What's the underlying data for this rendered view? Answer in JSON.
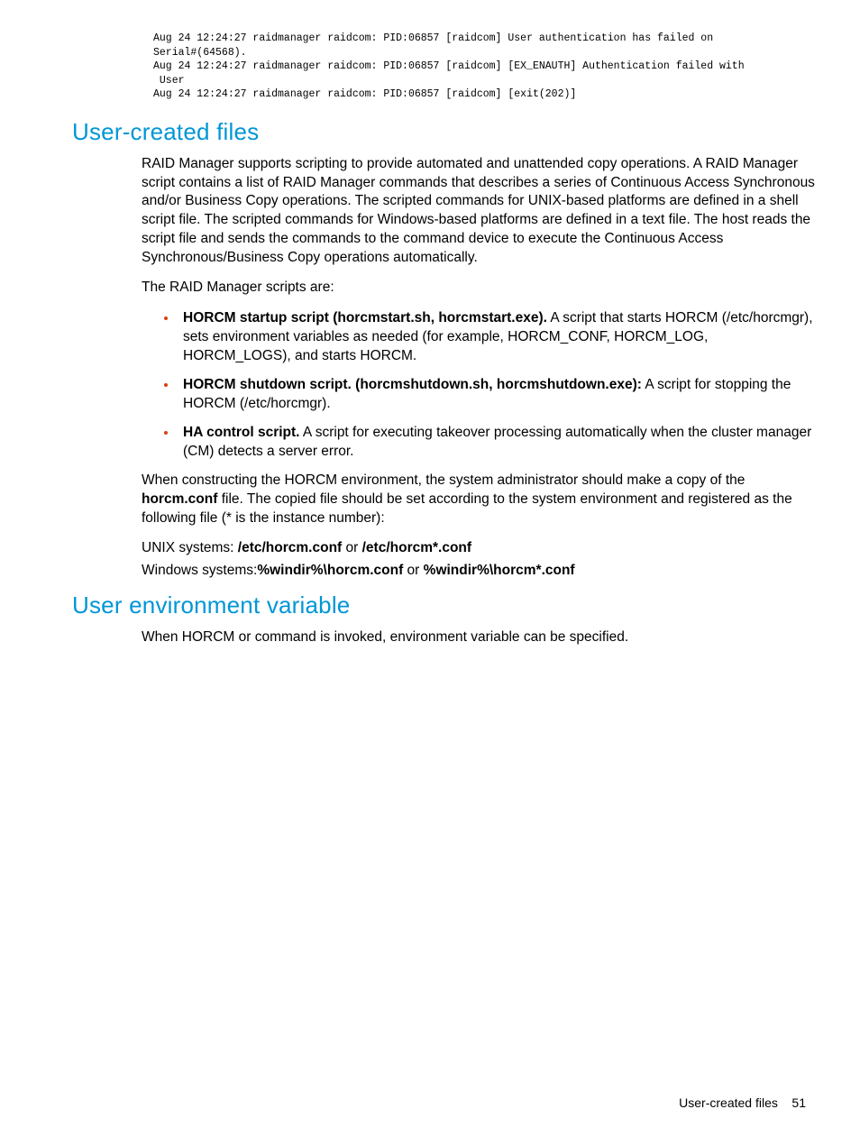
{
  "code": {
    "line1": "Aug 24 12:24:27 raidmanager raidcom: PID:06857 [raidcom] User authentication has failed on",
    "line2": "Serial#(64568).",
    "line3": "Aug 24 12:24:27 raidmanager raidcom: PID:06857 [raidcom] [EX_ENAUTH] Authentication failed with",
    "line4": " User",
    "line5": "Aug 24 12:24:27 raidmanager raidcom: PID:06857 [raidcom] [exit(202)]"
  },
  "section1": {
    "heading": "User-created files",
    "para1": "RAID Manager supports scripting to provide automated and unattended copy operations. A RAID Manager script contains a list of RAID Manager commands that describes a series of Continuous Access Synchronous and/or Business Copy operations. The scripted commands for UNIX-based platforms are defined in a shell script file. The scripted commands for Windows-based platforms are defined in a text file. The host reads the script file and sends the commands to the command device to execute the Continuous Access Synchronous/Business Copy operations automatically.",
    "para2": "The RAID Manager scripts are:",
    "bullets": [
      {
        "boldPart": "HORCM startup script (horcmstart.sh, horcmstart.exe).",
        "rest": " A script that starts HORCM (/etc/horcmgr), sets environment variables as needed (for example, HORCM_CONF, HORCM_LOG, HORCM_LOGS), and starts HORCM."
      },
      {
        "boldPart": "HORCM shutdown script. (horcmshutdown.sh, horcmshutdown.exe):",
        "rest": " A script for stopping the HORCM (/etc/horcmgr)."
      },
      {
        "boldPart": "HA control script.",
        "rest": " A script for executing takeover processing automatically when the cluster manager (CM) detects a server error."
      }
    ],
    "para3a": "When constructing the HORCM environment, the system administrator should make a copy of the ",
    "para3bold": "horcm.conf",
    "para3b": " file. The copied file should be set according to the system environment and registered as the following file (* is the instance number):",
    "unixLabel": "UNIX systems: ",
    "unixPath1": "/etc/horcm.conf",
    "unixOr": " or ",
    "unixPath2": "/etc/horcm*.conf",
    "winLabel": "Windows systems:",
    "winPath1": "%windir%\\horcm.conf",
    "winOr": " or ",
    "winPath2": "%windir%\\horcm*.conf"
  },
  "section2": {
    "heading": "User environment variable",
    "para1": "When HORCM or command is invoked, environment variable can be specified."
  },
  "footer": {
    "label": "User-created files",
    "page": "51"
  }
}
